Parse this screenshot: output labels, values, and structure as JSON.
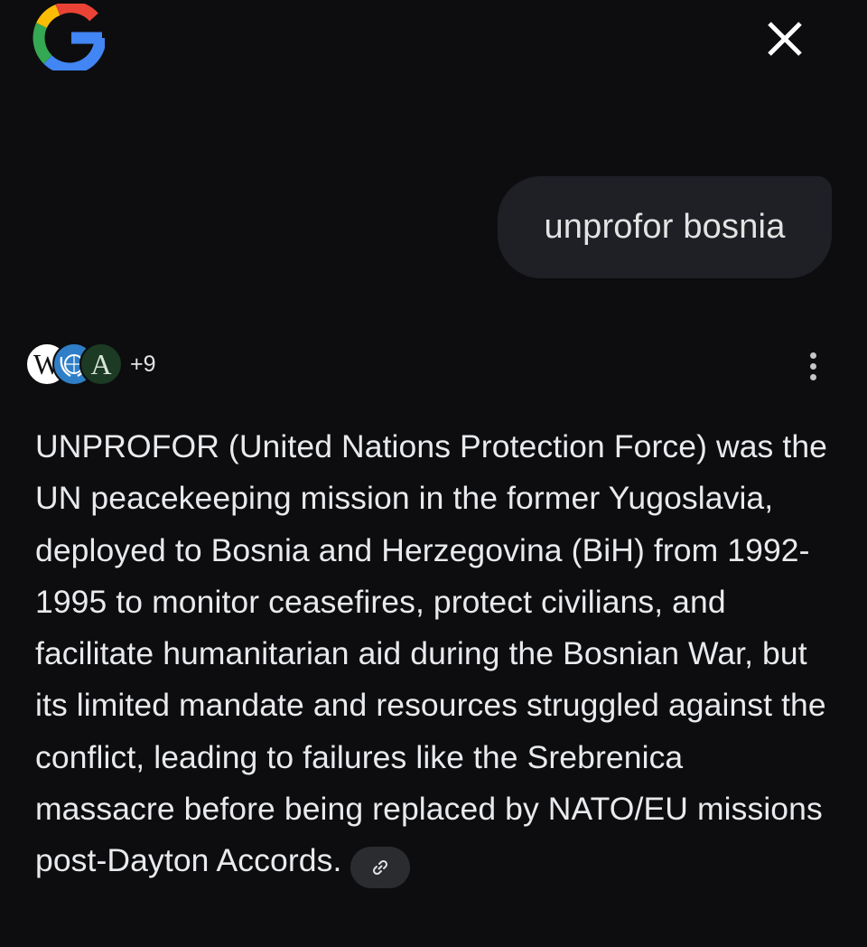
{
  "header": {
    "logo_icon": "google-g-logo",
    "close_icon": "close-icon"
  },
  "query": {
    "text": "unprofor bosnia"
  },
  "sources": {
    "icons": [
      "wikipedia-icon",
      "un-emblem-icon",
      "source-a-icon"
    ],
    "wikipedia_letter": "W",
    "a_letter": "A",
    "more_count": "+9",
    "menu_icon": "more-vert-icon"
  },
  "answer": {
    "text": "UNPROFOR (United Nations Protection Force) was the UN peacekeeping mission in the former Yugoslavia, deployed to Bosnia and Herzegovina (BiH) from 1992-1995 to monitor ceasefires, protect civilians, and facilitate humanitarian aid during the Bosnian War, but its limited mandate and resources struggled against the conflict, leading to failures like the Srebrenica massacre before being replaced by NATO/EU missions post-Dayton Accords.",
    "link_icon": "link-icon"
  },
  "colors": {
    "background": "#0d0d0f",
    "bubble": "#1f2026",
    "text": "#e8eaed",
    "chip": "#2b2c30",
    "google_blue": "#4285F4",
    "google_red": "#EA4335",
    "google_yellow": "#FBBC05",
    "google_green": "#34A853"
  }
}
